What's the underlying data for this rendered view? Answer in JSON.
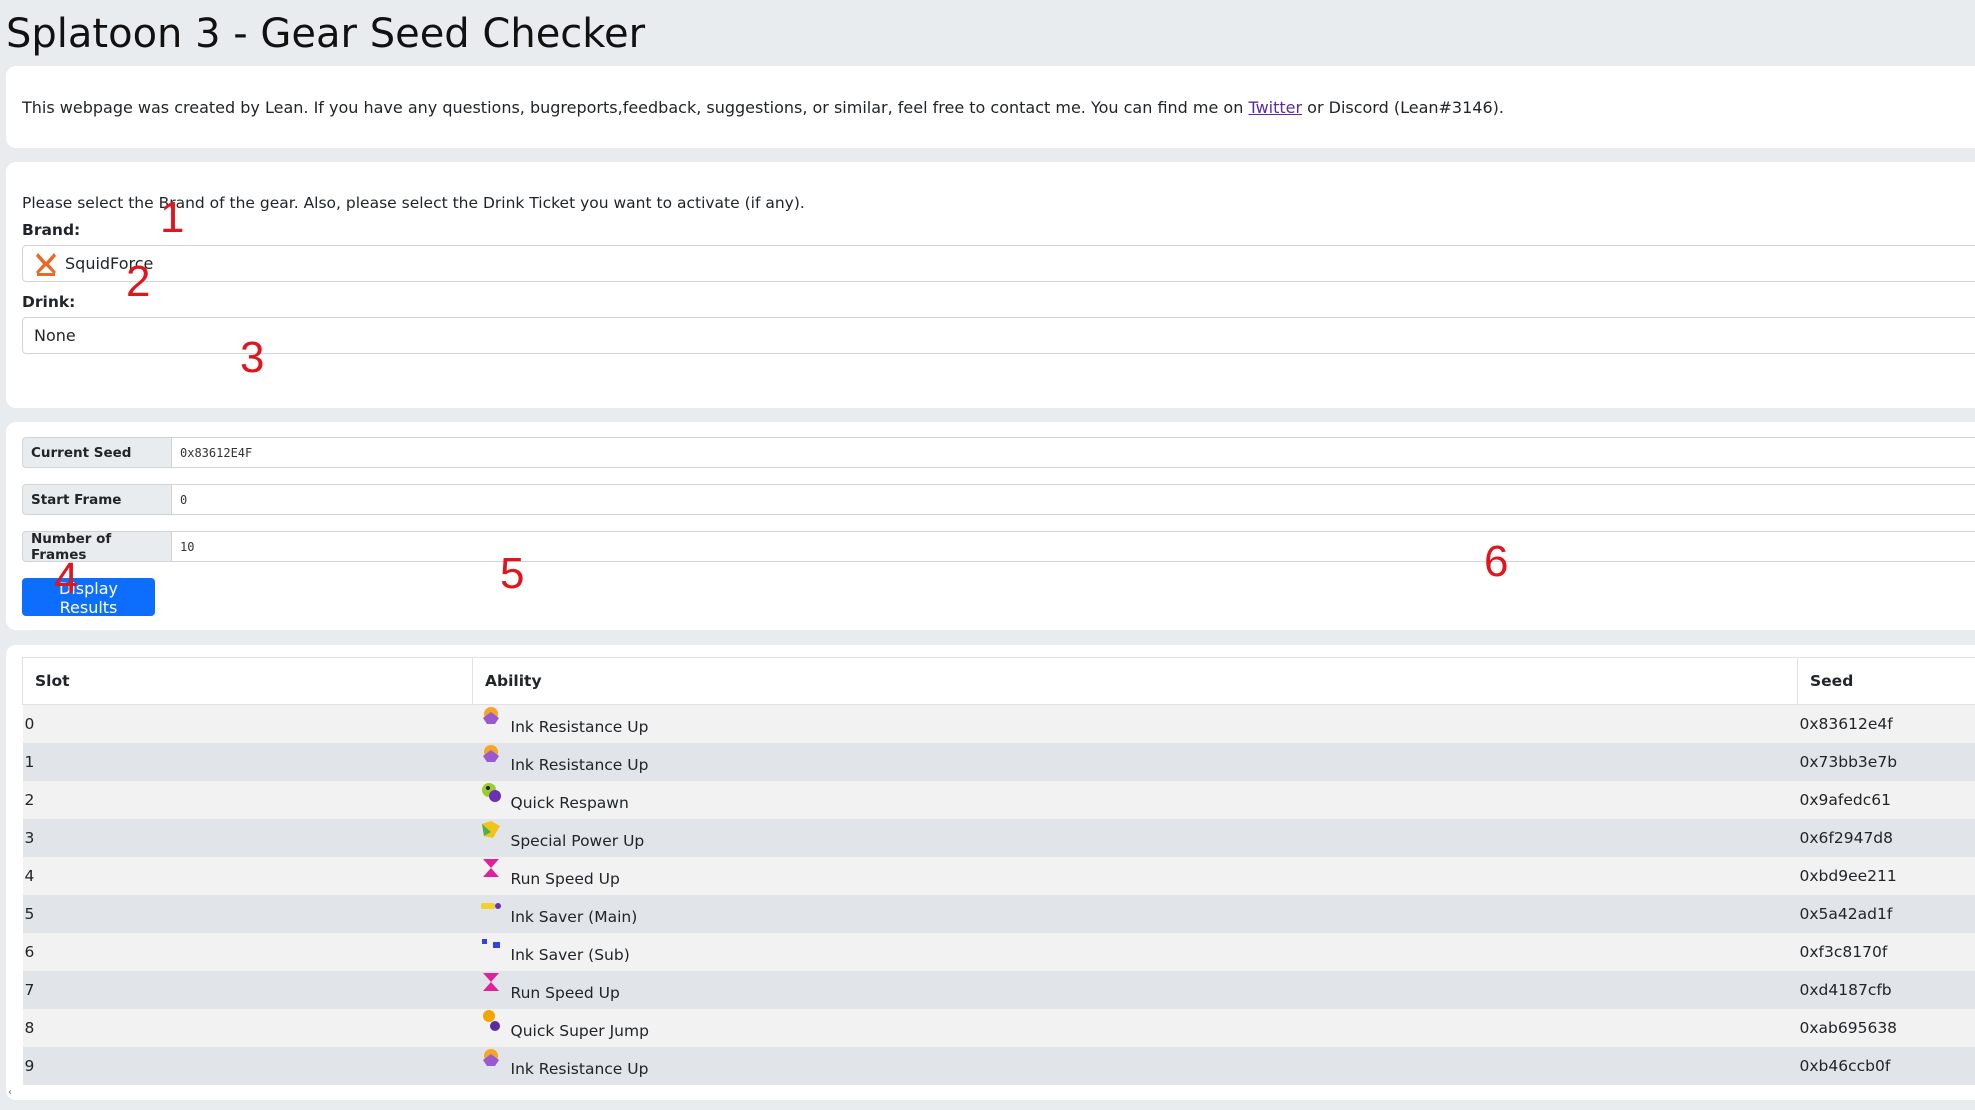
{
  "title": "Splatoon 3 - Gear Seed Checker",
  "info": {
    "text_before": "This webpage was created by Lean. If you have any questions, bugreports,feedback, suggestions, or similar, feel free to contact me. You can find me on ",
    "link_text": "Twitter",
    "text_after": " or Discord (Lean#3146)."
  },
  "selection": {
    "instructions": "Please select the Brand of the gear. Also, please select the Drink Ticket you want to activate (if any).",
    "brand_label": "Brand:",
    "brand_value": "SquidForce",
    "brand_icon": "squidforce-logo-icon",
    "drink_label": "Drink:",
    "drink_value": "None"
  },
  "params": {
    "current_seed_label": "Current Seed",
    "current_seed_value": "0x83612E4F",
    "start_frame_label": "Start Frame",
    "start_frame_value": "0",
    "num_frames_label": "Number of Frames",
    "num_frames_value": "10",
    "button_label": "Display Results"
  },
  "annotations": [
    "1",
    "2",
    "3",
    "4",
    "5",
    "6"
  ],
  "results": {
    "headers": {
      "slot": "Slot",
      "ability": "Ability",
      "seed": "Seed"
    },
    "rows": [
      {
        "slot": "0",
        "ability": "Ink Resistance Up",
        "icon": "ink-resistance-up-icon",
        "seed": "0x83612e4f"
      },
      {
        "slot": "1",
        "ability": "Ink Resistance Up",
        "icon": "ink-resistance-up-icon",
        "seed": "0x73bb3e7b"
      },
      {
        "slot": "2",
        "ability": "Quick Respawn",
        "icon": "quick-respawn-icon",
        "seed": "0x9afedc61"
      },
      {
        "slot": "3",
        "ability": "Special Power Up",
        "icon": "special-power-up-icon",
        "seed": "0x6f2947d8"
      },
      {
        "slot": "4",
        "ability": "Run Speed Up",
        "icon": "run-speed-up-icon",
        "seed": "0xbd9ee211"
      },
      {
        "slot": "5",
        "ability": "Ink Saver (Main)",
        "icon": "ink-saver-main-icon",
        "seed": "0x5a42ad1f"
      },
      {
        "slot": "6",
        "ability": "Ink Saver (Sub)",
        "icon": "ink-saver-sub-icon",
        "seed": "0xf3c8170f"
      },
      {
        "slot": "7",
        "ability": "Run Speed Up",
        "icon": "run-speed-up-icon",
        "seed": "0xd4187cfb"
      },
      {
        "slot": "8",
        "ability": "Quick Super Jump",
        "icon": "quick-super-jump-icon",
        "seed": "0xab695638"
      },
      {
        "slot": "9",
        "ability": "Ink Resistance Up",
        "icon": "ink-resistance-up-icon",
        "seed": "0xb46ccb0f"
      }
    ]
  },
  "colors": {
    "page_bg": "#e9ecef",
    "primary_button": "#0d6efd",
    "annotation": "#e0151d",
    "link": "#5a2ca0"
  }
}
